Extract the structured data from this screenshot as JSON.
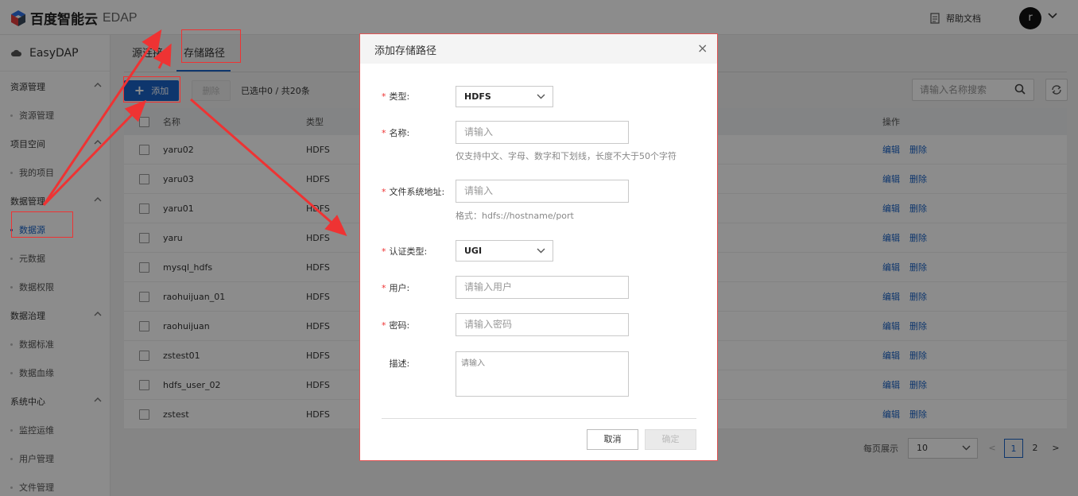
{
  "brand": {
    "name": "百度智能云",
    "product": "EDAP"
  },
  "header": {
    "help_label": "帮助文档",
    "avatar_letter": "r"
  },
  "sidebar": {
    "app_name": "EasyDAP",
    "groups": [
      {
        "label": "资源管理",
        "items": [
          {
            "label": "资源管理"
          }
        ]
      },
      {
        "label": "项目空间",
        "items": [
          {
            "label": "我的项目"
          }
        ]
      },
      {
        "label": "数据管理",
        "items": [
          {
            "label": "数据源",
            "active": true
          },
          {
            "label": "元数据"
          },
          {
            "label": "数据权限"
          }
        ]
      },
      {
        "label": "数据治理",
        "items": [
          {
            "label": "数据标准"
          },
          {
            "label": "数据血缘"
          }
        ]
      },
      {
        "label": "系统中心",
        "items": [
          {
            "label": "监控运维"
          },
          {
            "label": "用户管理"
          },
          {
            "label": "文件管理"
          }
        ]
      }
    ]
  },
  "tabs": [
    {
      "label": "源连接"
    },
    {
      "label": "存储路径",
      "active": true
    }
  ],
  "toolbar": {
    "add_label": "添加",
    "delete_label": "删除",
    "selection": "已选中0 / 共20条",
    "search_placeholder": "请输入名称搜索"
  },
  "table": {
    "columns": [
      "名称",
      "类型",
      "操作"
    ],
    "rows": [
      {
        "name": "yaru02",
        "type": "HDFS"
      },
      {
        "name": "yaru03",
        "type": "HDFS"
      },
      {
        "name": "yaru01",
        "type": "HDFS"
      },
      {
        "name": "yaru",
        "type": "HDFS"
      },
      {
        "name": "mysql_hdfs",
        "type": "HDFS"
      },
      {
        "name": "raohuijuan_01",
        "type": "HDFS"
      },
      {
        "name": "raohuijuan",
        "type": "HDFS"
      },
      {
        "name": "zstest01",
        "type": "HDFS"
      },
      {
        "name": "hdfs_user_02",
        "type": "HDFS"
      },
      {
        "name": "zstest",
        "type": "HDFS"
      }
    ],
    "edit_label": "编辑",
    "delete_label": "删除"
  },
  "pagination": {
    "page_size_label": "每页展示",
    "page_size": "10",
    "prev": "<",
    "next": ">",
    "pages": [
      "1",
      "2"
    ],
    "current": "1"
  },
  "modal": {
    "title": "添加存储路径",
    "close": "×",
    "fields": {
      "type": {
        "label": "类型:",
        "value": "HDFS"
      },
      "name": {
        "label": "名称:",
        "placeholder": "请输入",
        "hint": "仅支持中文、字母、数字和下划线，长度不大于50个字符"
      },
      "fs_address": {
        "label": "文件系统地址:",
        "placeholder": "请输入",
        "hint": "格式：hdfs://hostname/port"
      },
      "auth_type": {
        "label": "认证类型:",
        "value": "UGI"
      },
      "user": {
        "label": "用户:",
        "placeholder": "请输入用户"
      },
      "password": {
        "label": "密码:",
        "placeholder": "请输入密码"
      },
      "description": {
        "label": "描述:",
        "placeholder": "请输入"
      }
    },
    "cancel_label": "取消",
    "ok_label": "确定"
  },
  "colors": {
    "primary": "#1a63c7",
    "annotation": "#e33333",
    "overlay": "rgba(0,0,0,0.45)"
  }
}
